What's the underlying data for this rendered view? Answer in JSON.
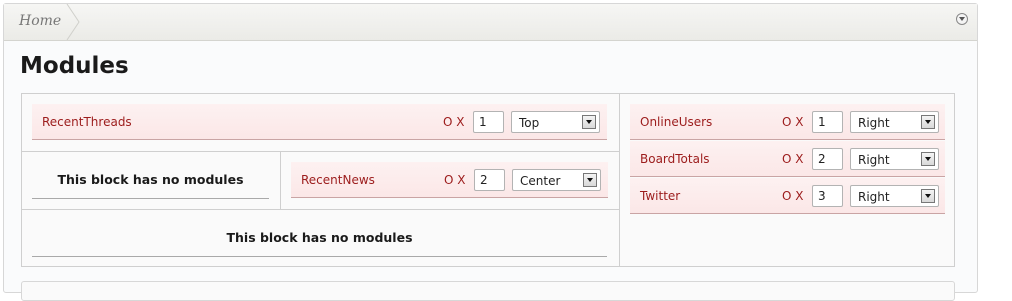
{
  "breadcrumb": {
    "home": "Home"
  },
  "page": {
    "title": "Modules"
  },
  "blocks": {
    "top": {
      "modules": [
        {
          "name": "RecentThreads",
          "options": "O",
          "remove": "X",
          "order": "1",
          "position": "Top"
        }
      ]
    },
    "middle_left": {
      "empty_message": "This block has no modules"
    },
    "middle_right": {
      "modules": [
        {
          "name": "RecentNews",
          "options": "O",
          "remove": "X",
          "order": "2",
          "position": "Center"
        }
      ]
    },
    "bottom": {
      "empty_message": "This block has no modules"
    },
    "side": {
      "modules": [
        {
          "name": "OnlineUsers",
          "options": "O",
          "remove": "X",
          "order": "1",
          "position": "Right"
        },
        {
          "name": "BoardTotals",
          "options": "O",
          "remove": "X",
          "order": "2",
          "position": "Right"
        },
        {
          "name": "Twitter",
          "options": "O",
          "remove": "X",
          "order": "3",
          "position": "Right"
        }
      ]
    }
  },
  "icons": {
    "jump": "chevron-down-circle-icon",
    "dropdown": "dropdown-arrow-icon"
  },
  "colors": {
    "module_link": "#9c1c1c",
    "row_bg": "#fbe7e7",
    "row_border": "#c9a4a4"
  }
}
